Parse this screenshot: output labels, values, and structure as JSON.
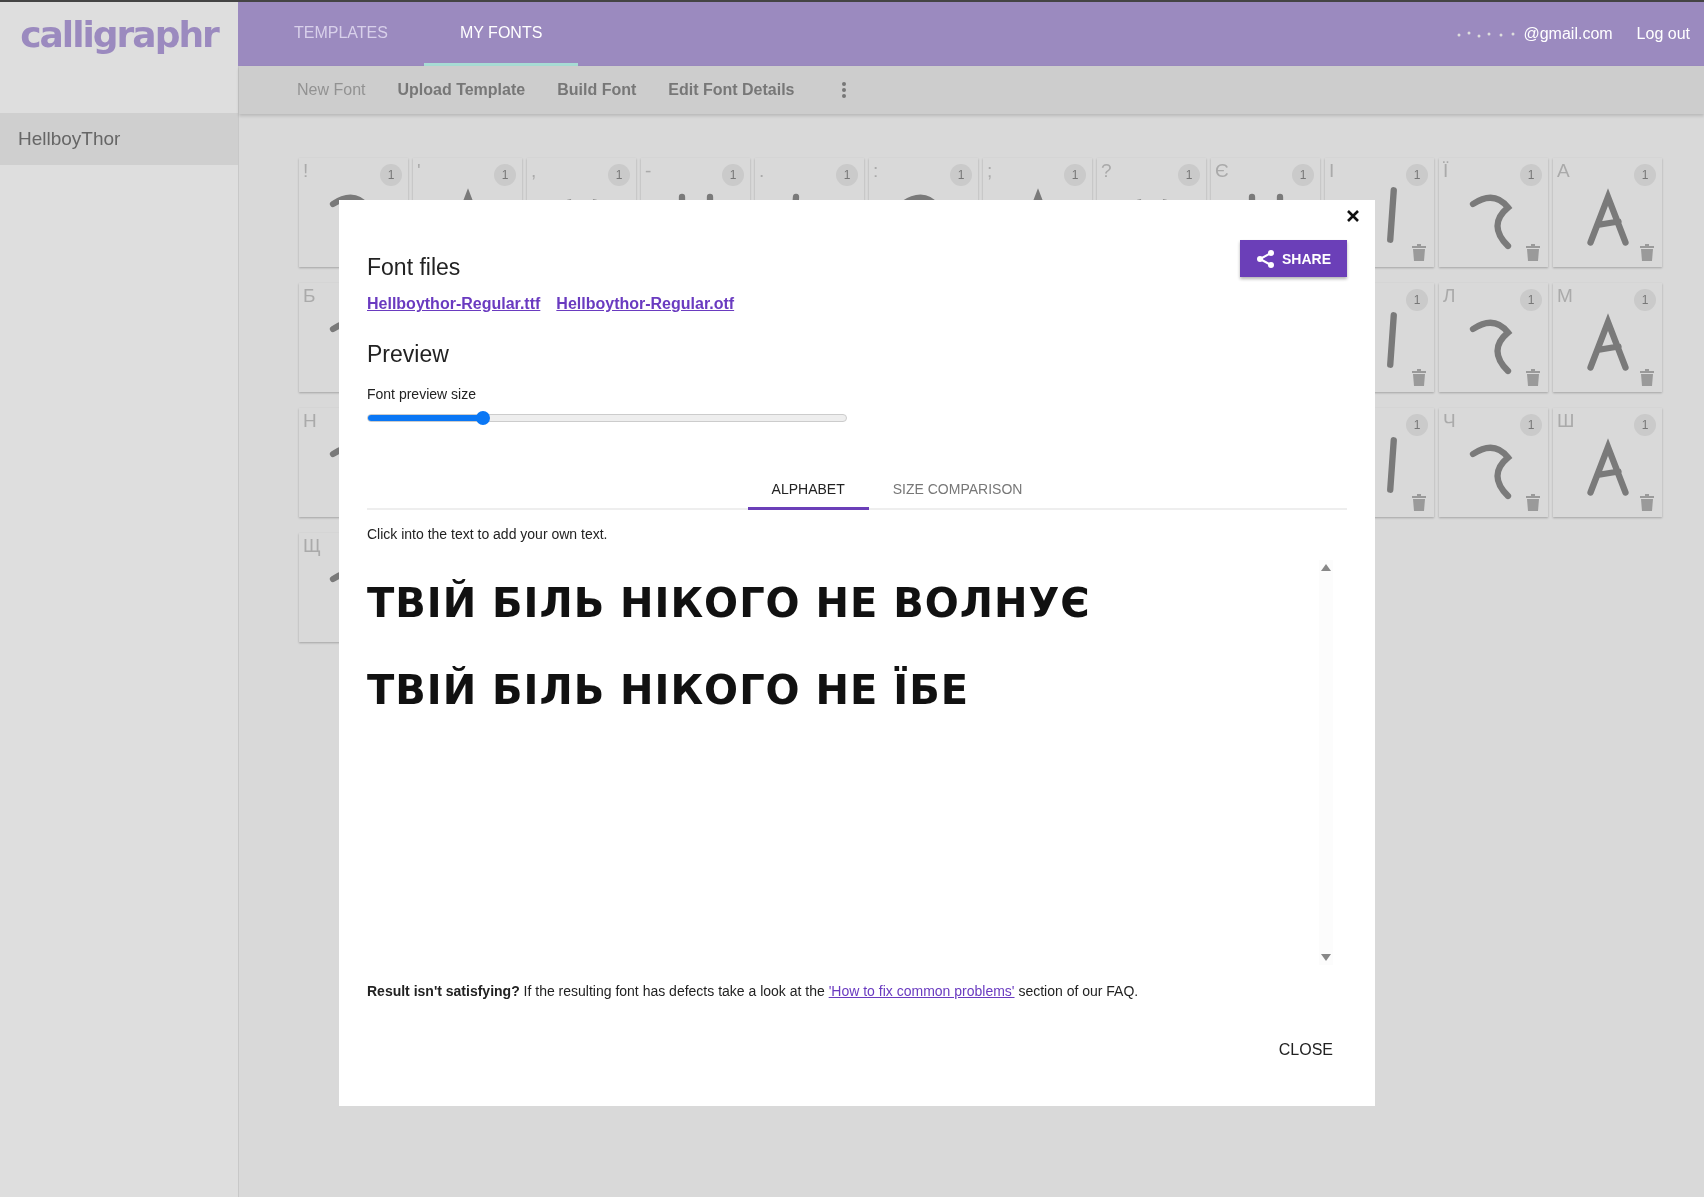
{
  "logo": "calligraphr",
  "top_tabs": [
    {
      "label": "TEMPLATES",
      "selected": false
    },
    {
      "label": "MY FONTS",
      "selected": true
    }
  ],
  "account": {
    "email": "@gmail.com",
    "logout": "Log out"
  },
  "toolbar": [
    {
      "label": "New Font",
      "disabled": true
    },
    {
      "label": "Upload Template",
      "disabled": false
    },
    {
      "label": "Build Font",
      "disabled": false
    },
    {
      "label": "Edit Font Details",
      "disabled": false
    }
  ],
  "sidebar": {
    "items": [
      {
        "label": "HellboyThor",
        "selected": true
      }
    ]
  },
  "glyph_rows": [
    {
      "left": [
        {
          "label": "!",
          "count": "1"
        },
        {
          "label": "'",
          "count": "1"
        },
        {
          "label": ",",
          "count": "1"
        },
        {
          "label": "-",
          "count": "1"
        },
        {
          "label": ".",
          "count": "1"
        },
        {
          "label": ":",
          "count": "1"
        },
        {
          "label": ";",
          "count": "1"
        },
        {
          "label": "?",
          "count": "1"
        },
        {
          "label": "Є",
          "count": "1"
        },
        {
          "label": "І",
          "count": "1"
        },
        {
          "label": "Ї",
          "count": "1"
        },
        {
          "label": "А",
          "count": "1"
        }
      ],
      "right": []
    },
    {
      "left": [
        {
          "label": "Б"
        }
      ],
      "right": [
        {
          "count": "1"
        },
        {
          "label": "Л",
          "count": "1"
        },
        {
          "label": "М",
          "count": "1"
        }
      ]
    },
    {
      "left": [
        {
          "label": "Н"
        }
      ],
      "right": [
        {
          "count": "1"
        },
        {
          "label": "Ч",
          "count": "1"
        },
        {
          "label": "Ш",
          "count": "1"
        }
      ]
    },
    {
      "left": [
        {
          "label": "Щ"
        }
      ],
      "right": []
    }
  ],
  "dialog": {
    "title": "Font files",
    "share": "SHARE",
    "files": [
      "Hellboythor-Regular.ttf",
      "Hellboythor-Regular.otf"
    ],
    "preview_title": "Preview",
    "size_label": "Font preview size",
    "size_slider": {
      "level": 0.24
    },
    "tabs": [
      {
        "label": "ALPHABET",
        "selected": true
      },
      {
        "label": "SIZE COMPARISON",
        "selected": false
      }
    ],
    "hint": "Click into the text to add your own text.",
    "preview_lines": [
      "ТВІЙ БІЛЬ НІКОГО НЕ ВОЛНУЄ",
      "ТВІЙ БІЛЬ НІКОГО НЕ ЇБЕ"
    ],
    "note": {
      "text": "**Result isn't satisfying?** If the resulting font has defects take a look at the",
      "link": "'How to fix common problems'",
      "after": "section of our FAQ."
    },
    "close": "CLOSE"
  }
}
